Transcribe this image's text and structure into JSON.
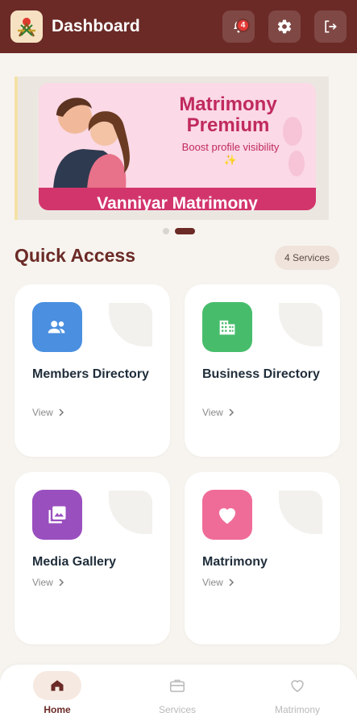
{
  "header": {
    "title": "Dashboard",
    "notification_count": "4"
  },
  "banner": {
    "title": "Matrimony Premium",
    "subtitle": "Boost profile visibility ✨",
    "brand": "Vanniyar Matrimony",
    "active_slide_index": 1,
    "slide_count": 2
  },
  "quick_access": {
    "title": "Quick Access",
    "services_count": "4 Services",
    "cards": [
      {
        "label": "Members Directory",
        "action": "View",
        "icon": "people-icon",
        "color": "#4a8fe0"
      },
      {
        "label": "Business Directory",
        "action": "View",
        "icon": "building-icon",
        "color": "#47bd6c"
      },
      {
        "label": "Media Gallery",
        "action": "View",
        "icon": "gallery-icon",
        "color": "#9a4fbf"
      },
      {
        "label": "Matrimony",
        "action": "View",
        "icon": "heart-icon",
        "color": "#f06c98"
      }
    ]
  },
  "bottom_nav": {
    "items": [
      {
        "label": "Home",
        "icon": "home-icon",
        "active": true
      },
      {
        "label": "Services",
        "icon": "briefcase-icon",
        "active": false
      },
      {
        "label": "Matrimony",
        "icon": "heart-outline-icon",
        "active": false
      }
    ]
  },
  "colors": {
    "primary": "#6b2a26",
    "background": "#f7f4ef",
    "banner_accent": "#d2356c"
  }
}
